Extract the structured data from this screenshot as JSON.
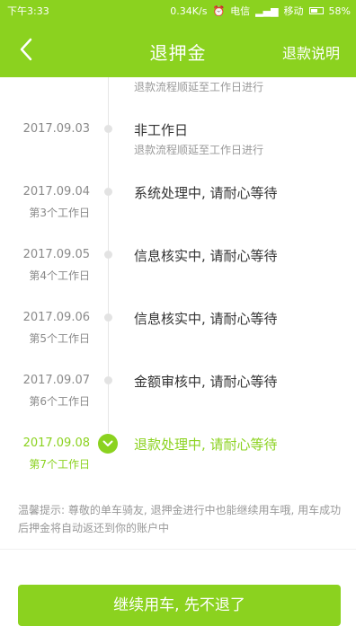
{
  "status_bar": {
    "time": "下午3:33",
    "network_speed": "0.34K/s",
    "carrier_1": "电信",
    "carrier_2": "移动",
    "battery": "58%"
  },
  "nav": {
    "title": "退押金",
    "help_label": "退款说明"
  },
  "timeline": {
    "items": [
      {
        "date": "",
        "day": "",
        "title": "",
        "sub": "退款流程顺延至工作日进行",
        "active": false
      },
      {
        "date": "2017.09.03",
        "day": "",
        "title": "非工作日",
        "sub": "退款流程顺延至工作日进行",
        "active": false
      },
      {
        "date": "2017.09.04",
        "day": "第3个工作日",
        "title": "系统处理中, 请耐心等待",
        "sub": "",
        "active": false
      },
      {
        "date": "2017.09.05",
        "day": "第4个工作日",
        "title": "信息核实中, 请耐心等待",
        "sub": "",
        "active": false
      },
      {
        "date": "2017.09.06",
        "day": "第5个工作日",
        "title": "信息核实中, 请耐心等待",
        "sub": "",
        "active": false
      },
      {
        "date": "2017.09.07",
        "day": "第6个工作日",
        "title": "金额审核中, 请耐心等待",
        "sub": "",
        "active": false
      },
      {
        "date": "2017.09.08",
        "day": "第7个工作日",
        "title": "退款处理中, 请耐心等待",
        "sub": "",
        "active": true
      }
    ]
  },
  "tip": {
    "text": "温馨提示: 尊敬的单车骑友, 退押金进行中也能继续用车哦, 用车成功后押金将自动返还到你的账户中"
  },
  "footer": {
    "button_label": "继续用车, 先不退了"
  },
  "colors": {
    "accent": "#8bd21f",
    "text_primary": "#333333",
    "text_secondary": "#8a8a8a"
  }
}
